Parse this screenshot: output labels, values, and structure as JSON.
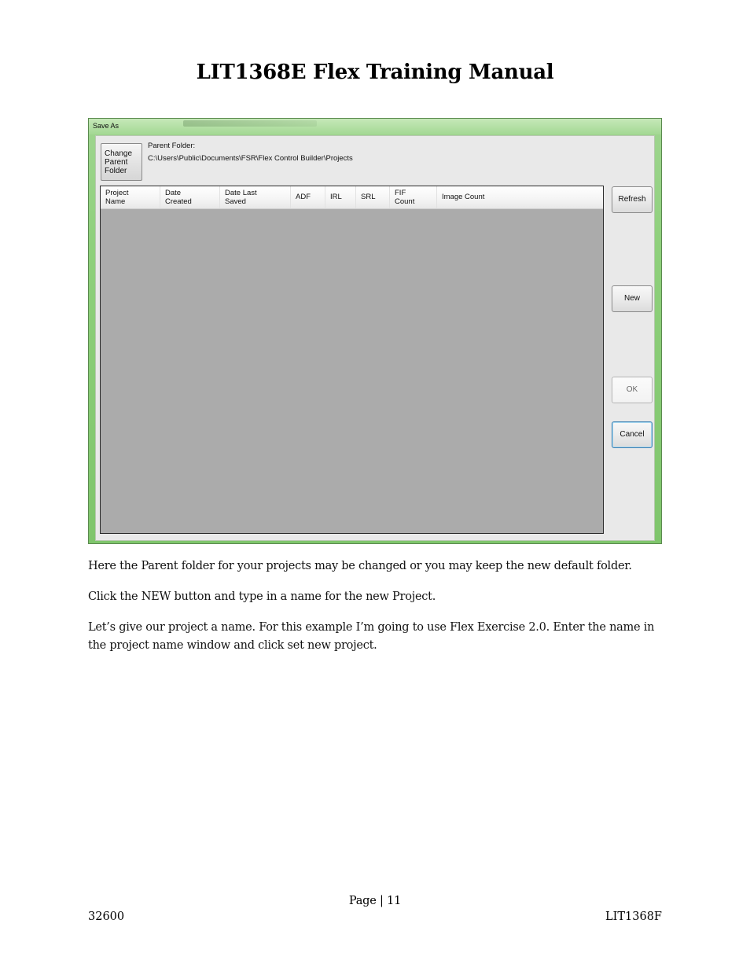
{
  "document": {
    "title": "LIT1368E Flex Training Manual",
    "paragraphs": [
      "Here the Parent folder for your projects may be changed or you may keep the new default folder.",
      "Click the NEW button and type in a name for the new Project.",
      "Let’s give our project a name. For this example I’m going to use Flex Exercise 2.0. Enter the name in the project name window and click set new project."
    ],
    "footer": {
      "page": "Page | 11",
      "left": "32600",
      "right": "LIT1368F"
    }
  },
  "dialog": {
    "title": "Save As",
    "change_parent_folder_label": "Change\nParent\nFolder",
    "parent_folder_label": "Parent Folder:",
    "parent_folder_path": "C:\\Users\\Public\\Documents\\FSR\\Flex Control Builder\\Projects",
    "columns": [
      "Project\nName",
      "Date\nCreated",
      "Date Last\nSaved",
      "ADF",
      "IRL",
      "SRL",
      "FIF\nCount",
      "Image Count"
    ],
    "rows": [],
    "buttons": {
      "refresh": "Refresh",
      "new": "New",
      "ok": "OK",
      "cancel": "Cancel"
    },
    "colors": {
      "frame": "#8fd07c",
      "client": "#e9e9e9",
      "list_background": "#ababab"
    }
  }
}
